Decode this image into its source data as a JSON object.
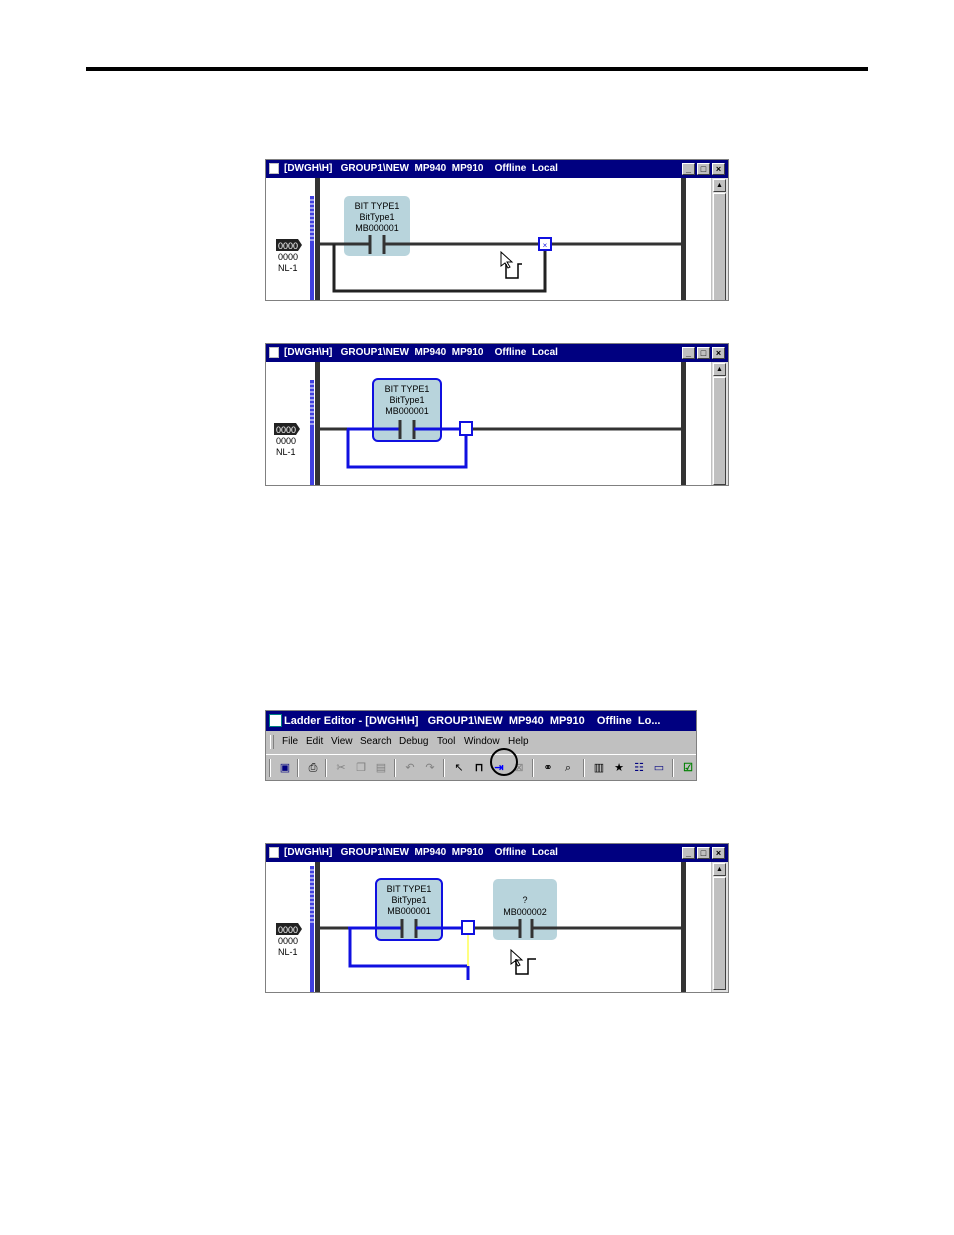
{
  "windows": [
    {
      "id": "win1",
      "title": "[DWGH\\H]   GROUP1\\NEW  MP940  MP910    Offline  Local",
      "rung_label": "0000",
      "rung_sub": "0000",
      "rung_nl": "NL-1",
      "contacts": [
        {
          "type": "BIT TYPE1",
          "name": "BitType1",
          "address": "MB000001"
        }
      ]
    },
    {
      "id": "win2",
      "title": "[DWGH\\H]   GROUP1\\NEW  MP940  MP910    Offline  Local",
      "rung_label": "0000",
      "rung_sub": "0000",
      "rung_nl": "NL-1",
      "contacts": [
        {
          "type": "BIT TYPE1",
          "name": "BitType1",
          "address": "MB000001"
        }
      ]
    },
    {
      "id": "win3",
      "title": "[DWGH\\H]   GROUP1\\NEW  MP940  MP910    Offline  Local",
      "rung_label": "0000",
      "rung_sub": "0000",
      "rung_nl": "NL-1",
      "contacts": [
        {
          "type": "BIT TYPE1",
          "name": "BitType1",
          "address": "MB000001"
        },
        {
          "type": "?",
          "name": "",
          "address": "MB000002"
        }
      ]
    }
  ],
  "ladder_editor": {
    "title": "Ladder Editor - [DWGH\\H]   GROUP1\\NEW  MP940  MP910    Offline  Lo...",
    "menu": [
      "File",
      "Edit",
      "View",
      "Search",
      "Debug",
      "Tool",
      "Window",
      "Help"
    ]
  },
  "colors": {
    "titlebar": "#000080",
    "selected_wire": "#0000ff",
    "contact_box": "#b8d4dc",
    "rail": "#333333"
  }
}
